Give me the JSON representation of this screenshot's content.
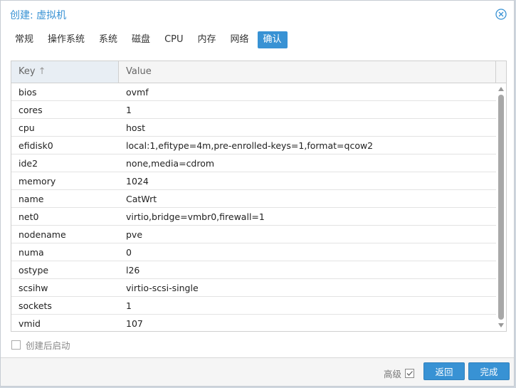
{
  "window": {
    "title": "创建: 虚拟机"
  },
  "tabs": [
    {
      "label": "常规"
    },
    {
      "label": "操作系统"
    },
    {
      "label": "系统"
    },
    {
      "label": "磁盘"
    },
    {
      "label": "CPU"
    },
    {
      "label": "内存"
    },
    {
      "label": "网络"
    },
    {
      "label": "确认",
      "active": true
    }
  ],
  "grid": {
    "columns": {
      "key": "Key",
      "value": "Value"
    },
    "sort": "ascending",
    "rows": [
      {
        "key": "bios",
        "value": "ovmf"
      },
      {
        "key": "cores",
        "value": "1"
      },
      {
        "key": "cpu",
        "value": "host"
      },
      {
        "key": "efidisk0",
        "value": "local:1,efitype=4m,pre-enrolled-keys=1,format=qcow2"
      },
      {
        "key": "ide2",
        "value": "none,media=cdrom"
      },
      {
        "key": "memory",
        "value": "1024"
      },
      {
        "key": "name",
        "value": "CatWrt"
      },
      {
        "key": "net0",
        "value": "virtio,bridge=vmbr0,firewall=1"
      },
      {
        "key": "nodename",
        "value": "pve"
      },
      {
        "key": "numa",
        "value": "0"
      },
      {
        "key": "ostype",
        "value": "l26"
      },
      {
        "key": "scsihw",
        "value": "virtio-scsi-single"
      },
      {
        "key": "sockets",
        "value": "1"
      },
      {
        "key": "vmid",
        "value": "107"
      }
    ]
  },
  "start_after_create": {
    "label": "创建后启动",
    "checked": false
  },
  "footer": {
    "advanced_label": "高级",
    "advanced_checked": true,
    "back_label": "返回",
    "finish_label": "完成"
  },
  "colors": {
    "accent": "#3892d4",
    "header_bg": "#f5f5f5"
  }
}
